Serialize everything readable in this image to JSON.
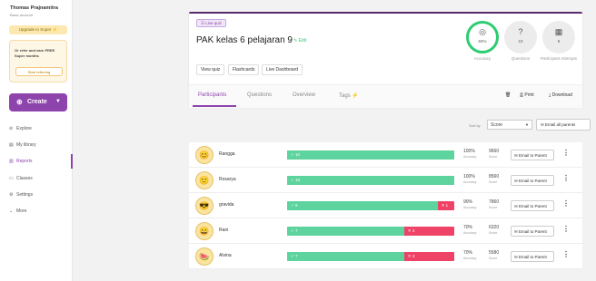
{
  "user": {
    "name": "Thomas Prajnamitra",
    "subtitle": "Basic account"
  },
  "upgrade": {
    "label": "Upgrade to Super",
    "icon": "bolt-icon"
  },
  "promo": {
    "text": "Or refer and earn FREE Super months",
    "button": "Start referring"
  },
  "create": {
    "label": "Create"
  },
  "nav": [
    {
      "label": "Explore",
      "icon": "compass-icon"
    },
    {
      "label": "My library",
      "icon": "library-icon"
    },
    {
      "label": "Reports",
      "icon": "reports-icon",
      "active": true
    },
    {
      "label": "Classes",
      "icon": "classes-icon"
    },
    {
      "label": "Settings",
      "icon": "gear-icon"
    },
    {
      "label": "More",
      "icon": "chevron-down-icon"
    }
  ],
  "quiz": {
    "badge": "Live quiz",
    "title": "PAK kelas 6 pelajaran 9",
    "edit": "Edit",
    "actions": [
      "View quiz",
      "Flashcards",
      "Live Dashboard"
    ]
  },
  "stats": [
    {
      "value": "84%",
      "label": "Accuracy",
      "icon": "target-icon"
    },
    {
      "value": "10",
      "label": "Questions",
      "icon": "question-icon"
    },
    {
      "value": "5",
      "label": "Participant Attempts",
      "icon": "participants-icon"
    }
  ],
  "tabs": [
    {
      "label": "Participants",
      "active": true
    },
    {
      "label": "Questions"
    },
    {
      "label": "Overview"
    },
    {
      "label": "Tags"
    }
  ],
  "tools": {
    "print": "Print",
    "download": "Download"
  },
  "sort": {
    "label": "Sort by",
    "value": "Score"
  },
  "email_all": "Email all parents",
  "email_parent_label": "Email to Parent",
  "accuracy_label": "Accuracy",
  "score_label": "Score",
  "participants": [
    {
      "name": "Rangga",
      "correct": 10,
      "wrong": 0,
      "correct_text": "✓ 10",
      "wrong_text": "",
      "accuracy": "100%",
      "score": "9660"
    },
    {
      "name": "Rosarya",
      "correct": 10,
      "wrong": 0,
      "correct_text": "✓ 10",
      "wrong_text": "",
      "accuracy": "100%",
      "score": "8560"
    },
    {
      "name": "gravida",
      "correct": 9,
      "wrong": 1,
      "correct_text": "✓ 9",
      "wrong_text": "✕ 1",
      "accuracy": "90%",
      "score": "7860"
    },
    {
      "name": "Rani",
      "correct": 7,
      "wrong": 3,
      "correct_text": "✓ 7",
      "wrong_text": "✕ 3",
      "accuracy": "70%",
      "score": "6320"
    },
    {
      "name": "Alvina",
      "correct": 7,
      "wrong": 3,
      "correct_text": "✓ 7",
      "wrong_text": "✕ 3",
      "accuracy": "70%",
      "score": "5580"
    }
  ]
}
